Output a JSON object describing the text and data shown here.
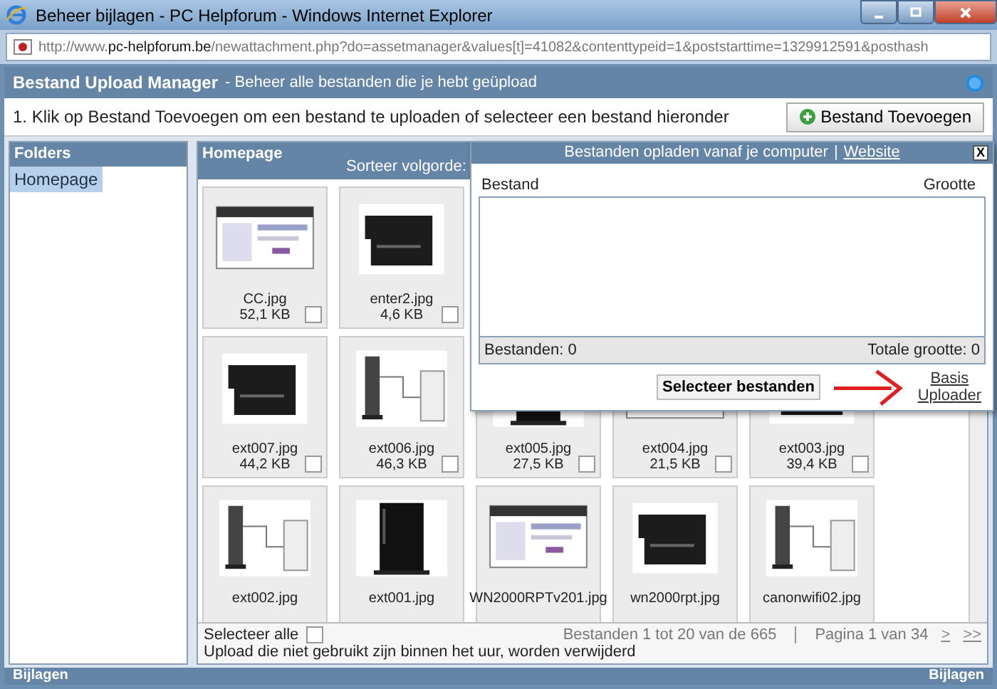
{
  "window": {
    "title": "Beheer bijlagen - PC Helpforum - Windows Internet Explorer"
  },
  "address_bar": {
    "prefix": "http://www.",
    "domain": "pc-helpforum.be",
    "path": "/newattachment.php?do=assetmanager&values[t]=41082&contenttypeid=1&poststarttime=1329912591&posthash"
  },
  "header": {
    "title": "Bestand Upload Manager",
    "subtitle": "- Beheer alle bestanden die je hebt geüpload"
  },
  "instruction": "1. Klik op Bestand Toevoegen om een bestand te uploaden of selecteer een bestand hieronder",
  "add_button": "Bestand Toevoegen",
  "folders": {
    "title": "Folders",
    "items": [
      {
        "label": "Homepage",
        "selected": true
      }
    ]
  },
  "files_panel": {
    "title": "Homepage",
    "sort_label": "Sorteer volgorde:",
    "rows": [
      [
        {
          "name": "CC.jpg",
          "size": "52,1 KB",
          "checked": false
        },
        {
          "name": "enter2.jpg",
          "size": "4,6 KB",
          "checked": false
        }
      ],
      [
        {
          "name": "ext007.jpg",
          "size": "44,2 KB",
          "checked": false
        },
        {
          "name": "ext006.jpg",
          "size": "46,3 KB",
          "checked": false
        },
        {
          "name": "ext005.jpg",
          "size": "27,5 KB",
          "checked": false
        },
        {
          "name": "ext004.jpg",
          "size": "21,5 KB",
          "checked": false
        },
        {
          "name": "ext003.jpg",
          "size": "39,4 KB",
          "checked": false
        }
      ],
      [
        {
          "name": "ext002.jpg"
        },
        {
          "name": "ext001.jpg"
        },
        {
          "name": "WN2000RPTv201.jpg"
        },
        {
          "name": "wn2000rpt.jpg"
        },
        {
          "name": "canonwifi02.jpg"
        }
      ]
    ],
    "select_all": {
      "label": "Selecteer alle",
      "checked": false
    },
    "range": "Bestanden 1 tot 20 van de 665",
    "page": "Pagina 1 van 34",
    "next": ">",
    "last": ">>",
    "note": "Upload die niet gebruikt zijn binnen het uur, worden verwijderd"
  },
  "upload_popup": {
    "title": "Bestanden opladen vanaf je computer",
    "separator": "|",
    "link": "Website",
    "close": "X",
    "col_file": "Bestand",
    "col_size": "Grootte",
    "count": "Bestanden: 0",
    "total": "Totale grootte: 0",
    "select_button": "Selecteer bestanden",
    "basic_link_1": "Basis",
    "basic_link_2": "Uploader"
  },
  "footer": {
    "left": "Bijlagen",
    "right": "Bijlagen"
  }
}
